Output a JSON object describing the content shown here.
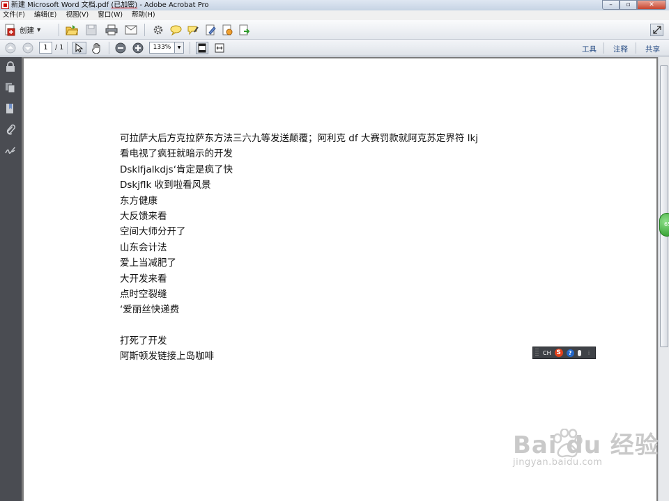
{
  "window": {
    "title_prefix": "新建 Microsoft Word 文档.pdf",
    "title_encrypted": "(已加密)",
    "title_suffix": " - Adobe Acrobat Pro",
    "min_glyph": "–",
    "max_glyph": "▫",
    "close_glyph": "✕"
  },
  "menu": [
    "文件(F)",
    "编辑(E)",
    "视图(V)",
    "窗口(W)",
    "帮助(H)"
  ],
  "toolbar": {
    "create_label": "创建",
    "create_caret": "▼"
  },
  "nav": {
    "page_current": "1",
    "page_total": "/ 1",
    "zoom": "133%",
    "zoom_caret": "▼"
  },
  "panels": {
    "tools": "工具",
    "comment": "注释",
    "share": "共享"
  },
  "document": {
    "lines": [
      "可拉萨大后方克拉萨东方法三六九等发送颠覆；阿利克 df 大赛罚款就阿克苏定界符 lkj",
      "看电视了疯狂就暗示的开发",
      "Dsklfjalkdjs‘肯定是疯了快",
      "Dskjflk 收到啦看风景",
      "东方健康",
      "大反馈来看",
      "空间大师分开了",
      "山东会计法",
      "爱上当减肥了",
      "大开发来看",
      "点时空裂缝",
      "‘爱丽丝快递费",
      "",
      "打死了开发",
      "阿斯顿发链接上岛咖啡"
    ]
  },
  "ime": {
    "lang": "CH",
    "brand_glyph": "S",
    "help_glyph": "?",
    "more": "⋮"
  },
  "side_badge": "65",
  "watermark": {
    "brand": "Bai du 经验",
    "url": "jingyan.baidu.com"
  },
  "colors": {
    "accent_link": "#2a4f86",
    "left_panel": "#4a4c52",
    "doc_background": "#7b7b7b"
  }
}
